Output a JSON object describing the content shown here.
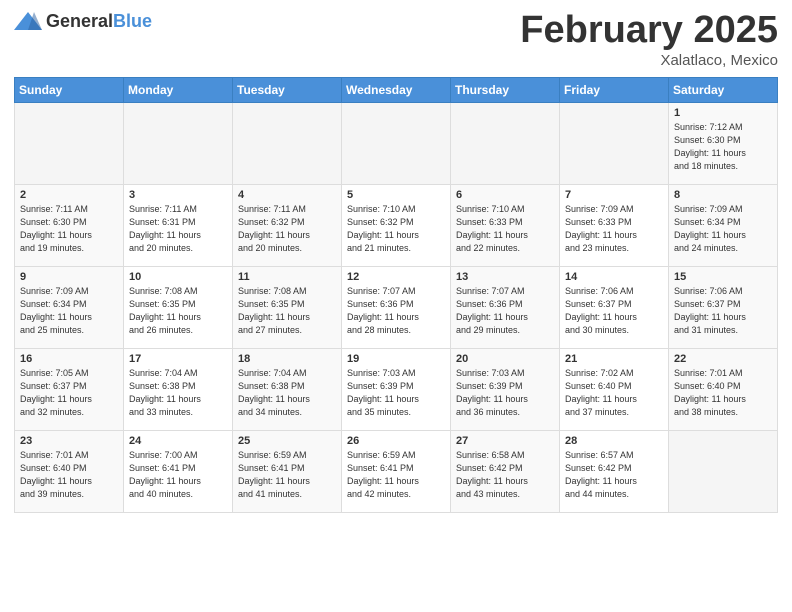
{
  "header": {
    "logo_general": "General",
    "logo_blue": "Blue",
    "month_title": "February 2025",
    "subtitle": "Xalatlaco, Mexico"
  },
  "weekdays": [
    "Sunday",
    "Monday",
    "Tuesday",
    "Wednesday",
    "Thursday",
    "Friday",
    "Saturday"
  ],
  "weeks": [
    [
      {
        "day": "",
        "info": ""
      },
      {
        "day": "",
        "info": ""
      },
      {
        "day": "",
        "info": ""
      },
      {
        "day": "",
        "info": ""
      },
      {
        "day": "",
        "info": ""
      },
      {
        "day": "",
        "info": ""
      },
      {
        "day": "1",
        "info": "Sunrise: 7:12 AM\nSunset: 6:30 PM\nDaylight: 11 hours\nand 18 minutes."
      }
    ],
    [
      {
        "day": "2",
        "info": "Sunrise: 7:11 AM\nSunset: 6:30 PM\nDaylight: 11 hours\nand 19 minutes."
      },
      {
        "day": "3",
        "info": "Sunrise: 7:11 AM\nSunset: 6:31 PM\nDaylight: 11 hours\nand 20 minutes."
      },
      {
        "day": "4",
        "info": "Sunrise: 7:11 AM\nSunset: 6:32 PM\nDaylight: 11 hours\nand 20 minutes."
      },
      {
        "day": "5",
        "info": "Sunrise: 7:10 AM\nSunset: 6:32 PM\nDaylight: 11 hours\nand 21 minutes."
      },
      {
        "day": "6",
        "info": "Sunrise: 7:10 AM\nSunset: 6:33 PM\nDaylight: 11 hours\nand 22 minutes."
      },
      {
        "day": "7",
        "info": "Sunrise: 7:09 AM\nSunset: 6:33 PM\nDaylight: 11 hours\nand 23 minutes."
      },
      {
        "day": "8",
        "info": "Sunrise: 7:09 AM\nSunset: 6:34 PM\nDaylight: 11 hours\nand 24 minutes."
      }
    ],
    [
      {
        "day": "9",
        "info": "Sunrise: 7:09 AM\nSunset: 6:34 PM\nDaylight: 11 hours\nand 25 minutes."
      },
      {
        "day": "10",
        "info": "Sunrise: 7:08 AM\nSunset: 6:35 PM\nDaylight: 11 hours\nand 26 minutes."
      },
      {
        "day": "11",
        "info": "Sunrise: 7:08 AM\nSunset: 6:35 PM\nDaylight: 11 hours\nand 27 minutes."
      },
      {
        "day": "12",
        "info": "Sunrise: 7:07 AM\nSunset: 6:36 PM\nDaylight: 11 hours\nand 28 minutes."
      },
      {
        "day": "13",
        "info": "Sunrise: 7:07 AM\nSunset: 6:36 PM\nDaylight: 11 hours\nand 29 minutes."
      },
      {
        "day": "14",
        "info": "Sunrise: 7:06 AM\nSunset: 6:37 PM\nDaylight: 11 hours\nand 30 minutes."
      },
      {
        "day": "15",
        "info": "Sunrise: 7:06 AM\nSunset: 6:37 PM\nDaylight: 11 hours\nand 31 minutes."
      }
    ],
    [
      {
        "day": "16",
        "info": "Sunrise: 7:05 AM\nSunset: 6:37 PM\nDaylight: 11 hours\nand 32 minutes."
      },
      {
        "day": "17",
        "info": "Sunrise: 7:04 AM\nSunset: 6:38 PM\nDaylight: 11 hours\nand 33 minutes."
      },
      {
        "day": "18",
        "info": "Sunrise: 7:04 AM\nSunset: 6:38 PM\nDaylight: 11 hours\nand 34 minutes."
      },
      {
        "day": "19",
        "info": "Sunrise: 7:03 AM\nSunset: 6:39 PM\nDaylight: 11 hours\nand 35 minutes."
      },
      {
        "day": "20",
        "info": "Sunrise: 7:03 AM\nSunset: 6:39 PM\nDaylight: 11 hours\nand 36 minutes."
      },
      {
        "day": "21",
        "info": "Sunrise: 7:02 AM\nSunset: 6:40 PM\nDaylight: 11 hours\nand 37 minutes."
      },
      {
        "day": "22",
        "info": "Sunrise: 7:01 AM\nSunset: 6:40 PM\nDaylight: 11 hours\nand 38 minutes."
      }
    ],
    [
      {
        "day": "23",
        "info": "Sunrise: 7:01 AM\nSunset: 6:40 PM\nDaylight: 11 hours\nand 39 minutes."
      },
      {
        "day": "24",
        "info": "Sunrise: 7:00 AM\nSunset: 6:41 PM\nDaylight: 11 hours\nand 40 minutes."
      },
      {
        "day": "25",
        "info": "Sunrise: 6:59 AM\nSunset: 6:41 PM\nDaylight: 11 hours\nand 41 minutes."
      },
      {
        "day": "26",
        "info": "Sunrise: 6:59 AM\nSunset: 6:41 PM\nDaylight: 11 hours\nand 42 minutes."
      },
      {
        "day": "27",
        "info": "Sunrise: 6:58 AM\nSunset: 6:42 PM\nDaylight: 11 hours\nand 43 minutes."
      },
      {
        "day": "28",
        "info": "Sunrise: 6:57 AM\nSunset: 6:42 PM\nDaylight: 11 hours\nand 44 minutes."
      },
      {
        "day": "",
        "info": ""
      }
    ]
  ]
}
